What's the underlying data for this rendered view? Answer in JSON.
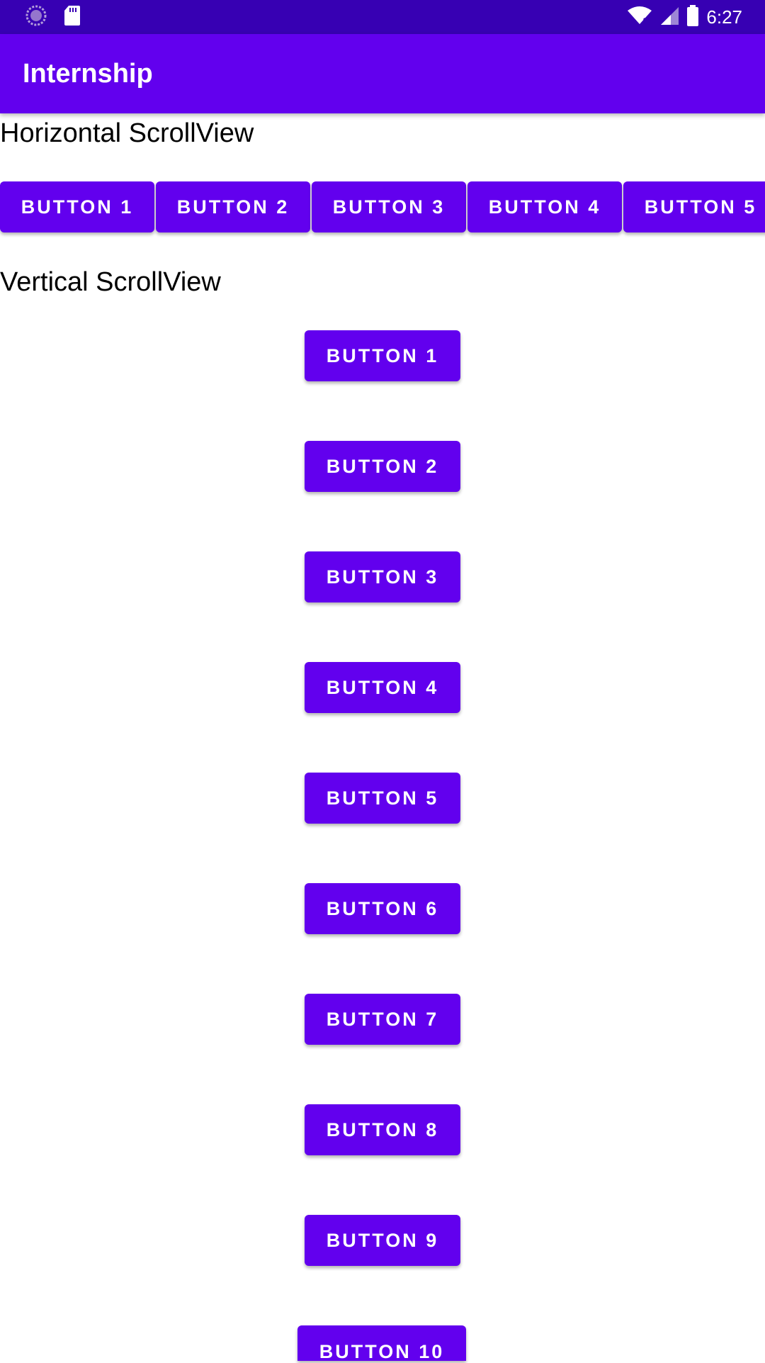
{
  "status_bar": {
    "time": "6:27",
    "left_icons": [
      "loading-icon",
      "sd-card-icon"
    ],
    "right_icons": [
      "wifi-icon",
      "signal-icon",
      "battery-icon"
    ]
  },
  "app_bar": {
    "title": "Internship"
  },
  "horizontal_section": {
    "heading": "Horizontal ScrollView",
    "buttons": [
      "BUTTON 1",
      "BUTTON 2",
      "BUTTON 3",
      "BUTTON 4",
      "BUTTON 5"
    ]
  },
  "vertical_section": {
    "heading": "Vertical ScrollView",
    "buttons": [
      "BUTTON 1",
      "BUTTON 2",
      "BUTTON 3",
      "BUTTON 4",
      "BUTTON 5",
      "BUTTON 6",
      "BUTTON 7",
      "BUTTON 8",
      "BUTTON 9",
      "BUTTON 10"
    ]
  },
  "colors": {
    "status_bar": "#3700b3",
    "primary": "#6200ee",
    "button_text": "#ffffff",
    "background": "#ffffff"
  }
}
